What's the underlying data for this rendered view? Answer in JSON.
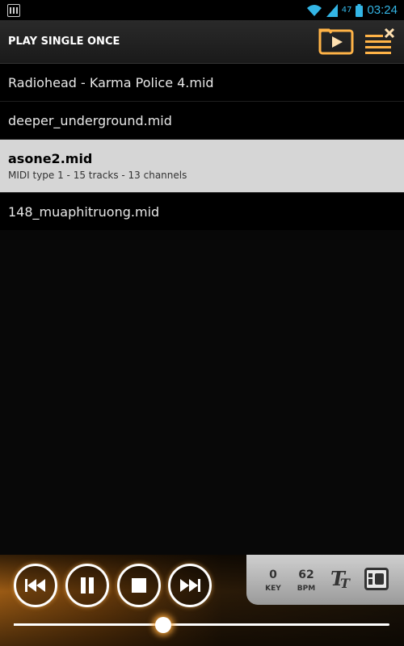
{
  "status_bar": {
    "signal_label": "47",
    "time": "03:24",
    "accent_color": "#33b5e5",
    "icons": [
      "app-notification-icon",
      "wifi-icon",
      "signal-icon",
      "battery-icon"
    ]
  },
  "header": {
    "title": "PLAY SINGLE ONCE",
    "buttons": [
      "play-folder-icon",
      "playlist-clear-icon"
    ]
  },
  "files": [
    {
      "name": "Radiohead - Karma Police 4.mid"
    },
    {
      "name": "deeper_underground.mid"
    },
    {
      "name": "asone2.mid",
      "details": "MIDI type 1 - 15 tracks - 13 channels",
      "selected": true
    },
    {
      "name": "148_muaphitruong.mid"
    }
  ],
  "player": {
    "controls": [
      "previous-icon",
      "pause-icon",
      "stop-icon",
      "next-icon"
    ],
    "key_value": "0",
    "key_label": "KEY",
    "bpm_value": "62",
    "bpm_label": "BPM",
    "progress": 0.4,
    "accent_color": "#ff9a2e"
  }
}
